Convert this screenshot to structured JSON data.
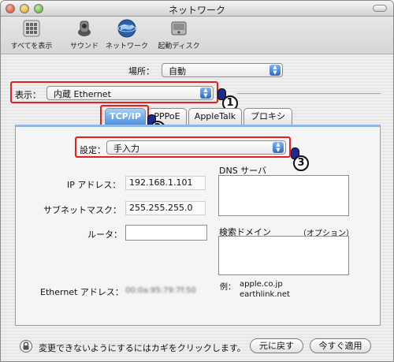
{
  "window": {
    "title": "ネットワーク"
  },
  "toolbar": {
    "items": [
      {
        "label": "すべてを表示",
        "icon": "show-all-icon"
      },
      {
        "label": "サウンド",
        "icon": "speaker-icon"
      },
      {
        "label": "ネットワーク",
        "icon": "globe-icon"
      },
      {
        "label": "起動ディスク",
        "icon": "disk-icon"
      }
    ]
  },
  "location": {
    "label": "場所：",
    "value": "自動"
  },
  "show": {
    "label": "表示：",
    "value": "内蔵 Ethernet"
  },
  "tabs": [
    {
      "label": "TCP/IP",
      "active": true
    },
    {
      "label": "PPPoE",
      "active": false
    },
    {
      "label": "AppleTalk",
      "active": false
    },
    {
      "label": "プロキシ",
      "active": false
    }
  ],
  "configure": {
    "label": "設定：",
    "value": "手入力"
  },
  "ip": {
    "label": "IP アドレス：",
    "value": "192.168.1.101"
  },
  "subnet": {
    "label": "サブネットマスク：",
    "value": "255.255.255.0"
  },
  "router": {
    "label": "ルータ：",
    "value": ""
  },
  "ethernet": {
    "label": "Ethernet アドレス：",
    "value": "00:0a:95:79:7f:50"
  },
  "dns": {
    "label": "DNS サーバ"
  },
  "search": {
    "label": "検索ドメイン",
    "optional": "（オプション）"
  },
  "example": {
    "label": "例：",
    "lines": [
      "apple.co.jp",
      "earthlink.net"
    ]
  },
  "footer": {
    "lock_text": "変更できないようにするにはカギをクリックします。",
    "revert_button": "元に戻す",
    "apply_button": "今すぐ適用"
  },
  "callouts": [
    "1",
    "2",
    "3"
  ],
  "colors": {
    "highlight": "#e32020",
    "tab_active": "#4f8ee0",
    "accent": "#2d69c4"
  }
}
